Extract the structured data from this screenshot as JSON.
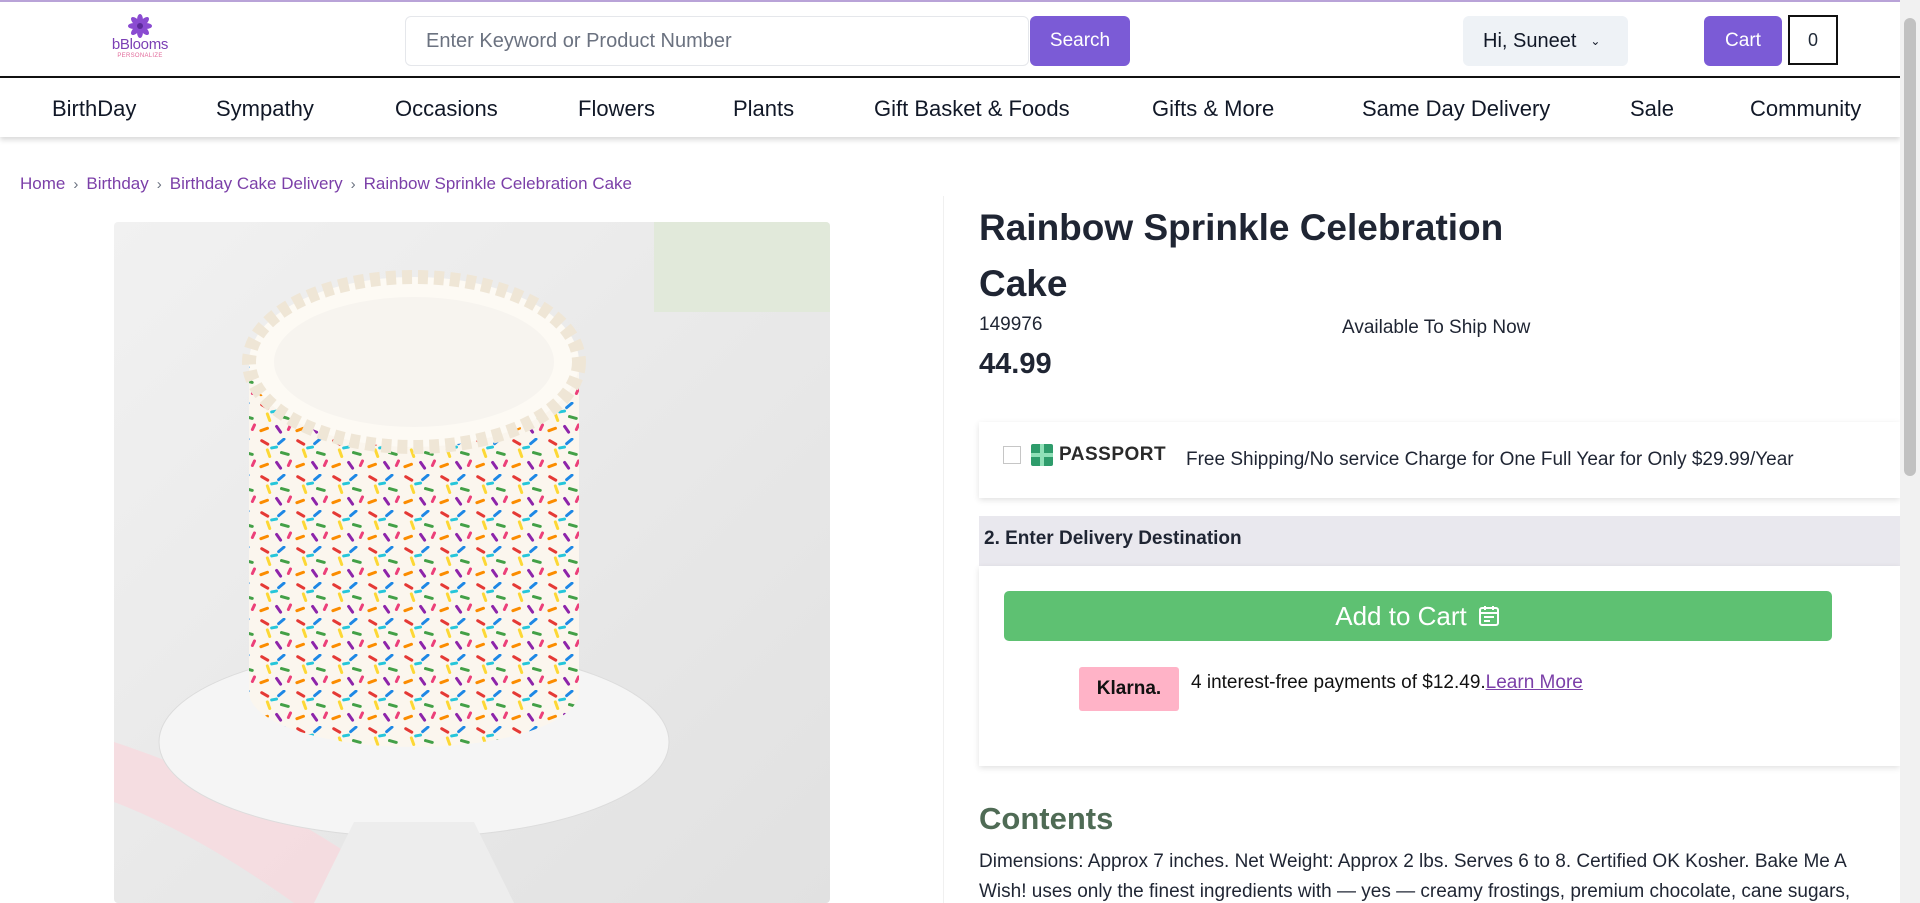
{
  "header": {
    "logo_text": "bBlooms",
    "logo_sub": "PERSONALIZE",
    "search_placeholder": "Enter Keyword or Product Number",
    "search_button": "Search",
    "user_greeting": "Hi, Suneet",
    "cart_label": "Cart",
    "cart_count": "0"
  },
  "nav": {
    "items": [
      {
        "label": "BirthDay"
      },
      {
        "label": "Sympathy"
      },
      {
        "label": "Occasions"
      },
      {
        "label": "Flowers"
      },
      {
        "label": "Plants"
      },
      {
        "label": "Gift Basket & Foods"
      },
      {
        "label": "Gifts & More"
      },
      {
        "label": "Same Day Delivery"
      },
      {
        "label": "Sale"
      },
      {
        "label": "Community"
      }
    ]
  },
  "breadcrumb": [
    "Home",
    "Birthday",
    "Birthday Cake Delivery",
    "Rainbow Sprinkle Celebration Cake"
  ],
  "product": {
    "title": "Rainbow Sprinkle Celebration Cake",
    "sku": "149976",
    "availability": "Available To Ship Now",
    "price": "44.99"
  },
  "passport": {
    "brand": "PASSPORT",
    "text": "Free Shipping/No service Charge for One Full Year for Only $29.99/Year"
  },
  "delivery": {
    "step_label": "2. Enter Delivery Destination"
  },
  "cart_section": {
    "add_to_cart": "Add to Cart",
    "klarna_badge": "Klarna.",
    "klarna_text": "4 interest-free payments of $12.49.",
    "klarna_link": "Learn More"
  },
  "contents": {
    "title": "Contents",
    "text": "Dimensions: Approx 7 inches. Net Weight: Approx 2 lbs. Serves 6 to 8. Certified OK Kosher. Bake Me A Wish! uses only the finest ingredients with — yes — creamy frostings, premium chocolate, cane sugars,"
  }
}
